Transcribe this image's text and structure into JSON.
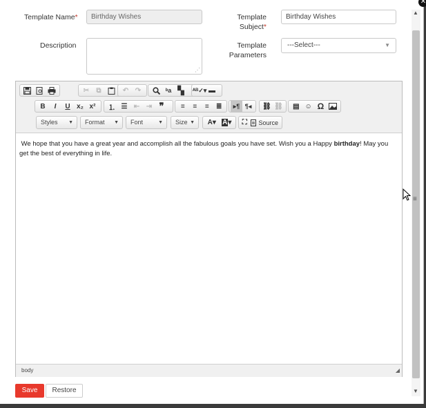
{
  "form": {
    "template_name_label": "Template Name",
    "template_name_value": "Birthday Wishes",
    "template_subject_label_1": "Template",
    "template_subject_label_2": "Subject",
    "template_subject_value": "Birthday Wishes",
    "description_label": "Description",
    "description_value": "",
    "parameters_label_1": "Template",
    "parameters_label_2": "Parameters",
    "parameters_selected": "---Select---",
    "required_marker": "*"
  },
  "editor": {
    "toolbar_row3": {
      "styles": "Styles",
      "format": "Format",
      "font": "Font",
      "size": "Size",
      "source": "Source"
    },
    "icons": [
      "save-icon",
      "preview-icon",
      "print-icon",
      "cut-icon",
      "copy-icon",
      "paste-icon",
      "undo-icon",
      "redo-icon",
      "find-icon",
      "replace-icon",
      "template-icon",
      "spellcheck-icon",
      "hr-field-icon",
      "bold-icon",
      "italic-icon",
      "underline-icon",
      "subscript-icon",
      "superscript-icon",
      "numbered-list-icon",
      "bulleted-list-icon",
      "outdent-icon",
      "indent-icon",
      "blockquote-icon",
      "align-left-icon",
      "align-center-icon",
      "align-right-icon",
      "justify-icon",
      "ltr-icon",
      "rtl-icon",
      "link-icon",
      "unlink-icon",
      "horizontal-rule-icon",
      "smiley-icon",
      "omega-icon",
      "image-icon",
      "text-color-icon",
      "bg-color-icon",
      "maximize-icon"
    ],
    "content_before": "We hope that you have a great year and accomplish all the fabulous goals you have set. Wish you a Happy ",
    "content_bold": "birthday",
    "content_after": "! May you get the best of everything in life.",
    "status_path": "body"
  },
  "buttons": {
    "save": "Save",
    "restore": "Restore"
  },
  "colors": {
    "accent": "#e8392c",
    "required": "#c0392b"
  }
}
